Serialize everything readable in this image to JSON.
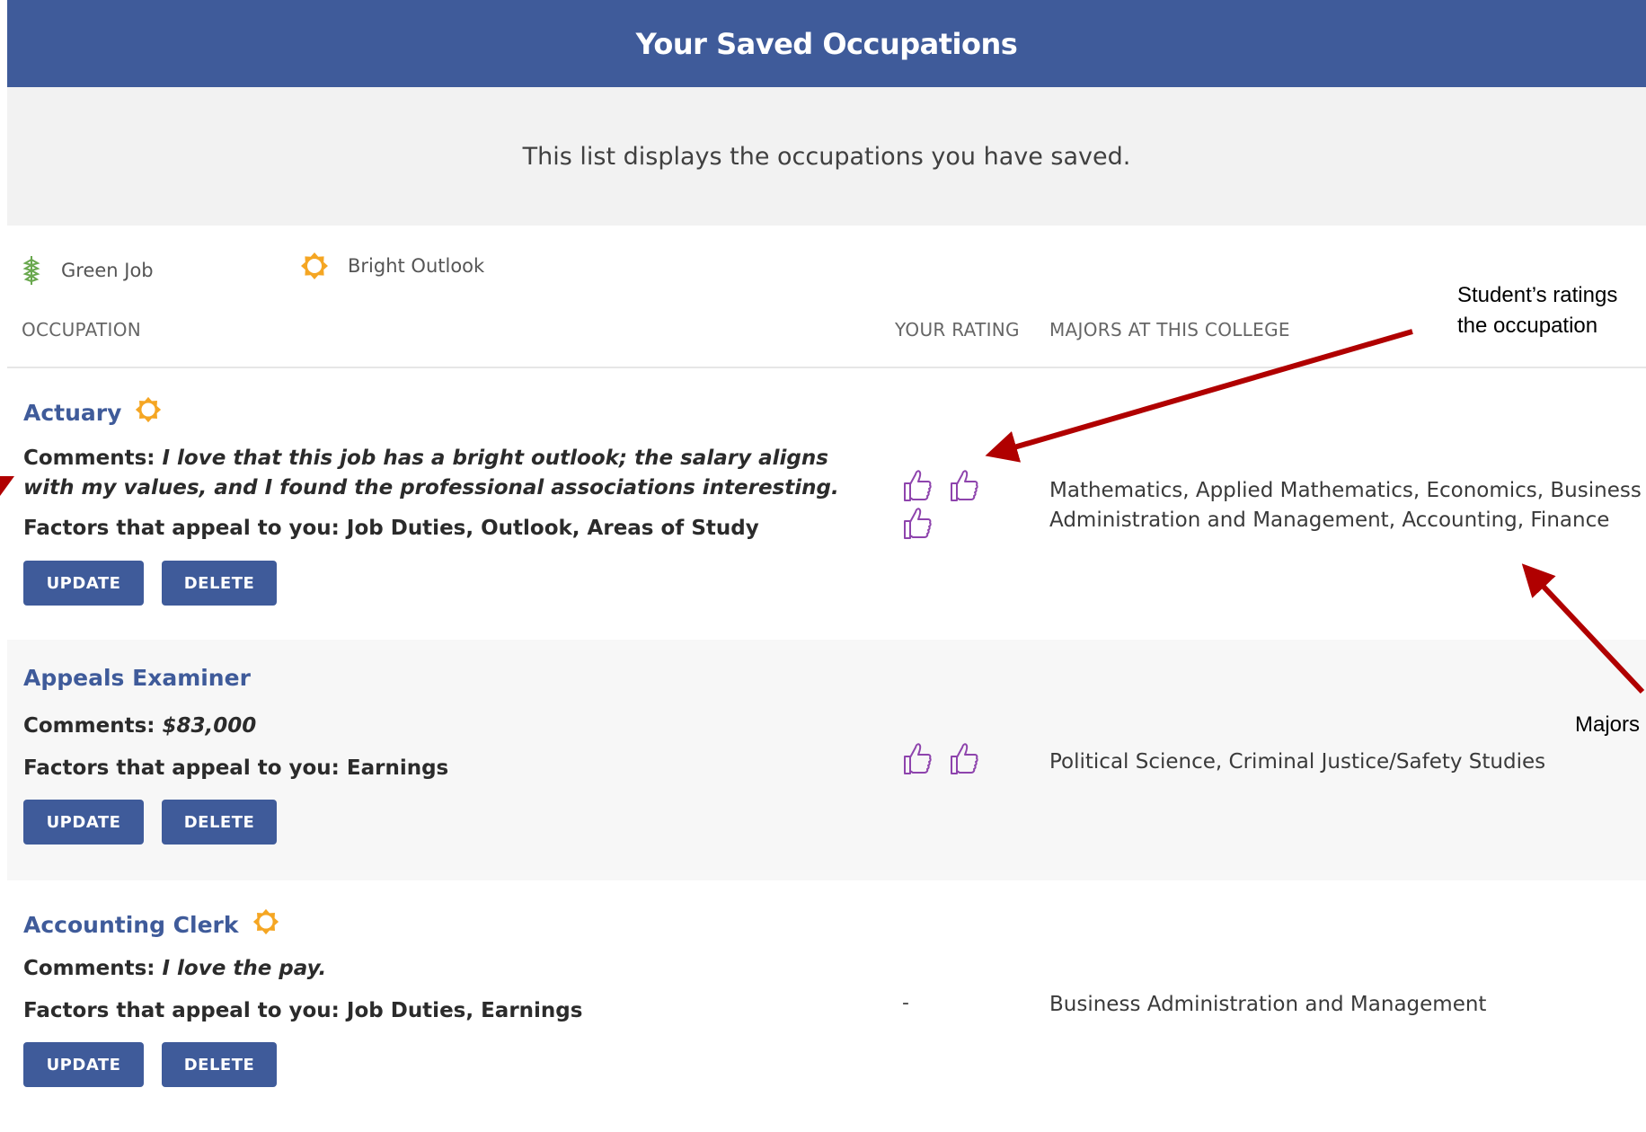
{
  "header": {
    "title": "Your Saved Occupations"
  },
  "subtitle": "This list displays the occupations you have saved.",
  "legend": {
    "green_job": "Green Job",
    "bright_outlook": "Bright Outlook"
  },
  "columns": {
    "occupation": "OCCUPATION",
    "your_rating": "YOUR RATING",
    "majors": "MAJORS AT THIS COLLEGE"
  },
  "labels": {
    "comments": "Comments:",
    "factors": "Factors that appeal to you:",
    "update": "UPDATE",
    "delete": "DELETE"
  },
  "occupations": [
    {
      "title": "Actuary",
      "bright_outlook": true,
      "comment": "I love that this job has a bright outlook; the salary aligns with my values, and I found the professional associations interesting.",
      "factors": "Job Duties, Outlook, Areas of Study",
      "rating": 3,
      "majors": "Mathematics, Applied Mathematics, Economics, Business Administration and Management, Accounting, Finance"
    },
    {
      "title": "Appeals Examiner",
      "bright_outlook": false,
      "comment": "$83,000",
      "factors": "Earnings",
      "rating": 2,
      "majors": "Political Science, Criminal Justice/Safety Studies"
    },
    {
      "title": "Accounting Clerk",
      "bright_outlook": true,
      "comment": "I love the pay.",
      "factors": "Job Duties, Earnings",
      "rating": 0,
      "rating_text": "-",
      "majors": "Business Administration and Management"
    }
  ],
  "annotations": {
    "ratings_note_line1": "Student’s ratings",
    "ratings_note_line2": "the occupation",
    "majors_note": "Majors"
  },
  "colors": {
    "header_bg": "#3f5b9a",
    "link": "#3f5b9a",
    "bright_outlook": "#f5a623",
    "green_job": "#6aa84f",
    "thumb": "#8e44ad",
    "annotation_arrow": "#b00000"
  }
}
